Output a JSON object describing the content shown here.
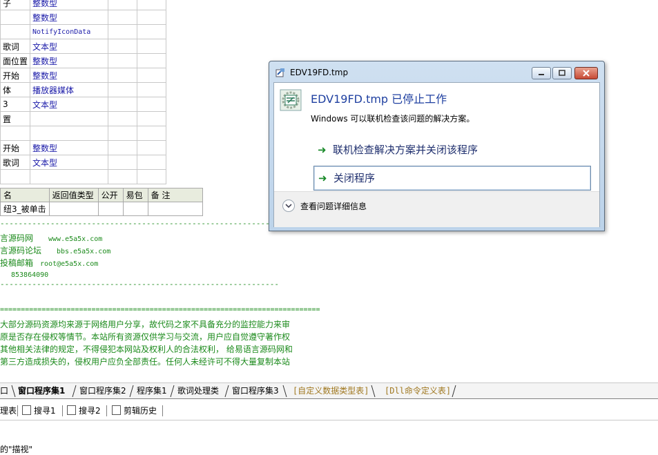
{
  "var_table": {
    "rows": [
      {
        "name": "子",
        "type": "整数型"
      },
      {
        "name": "",
        "type": "整数型"
      },
      {
        "name": "",
        "type": "NotifyIconData"
      },
      {
        "name": "歌词",
        "type": "文本型"
      },
      {
        "name": "面位置",
        "type": "整数型"
      },
      {
        "name": "开始",
        "type": "整数型"
      },
      {
        "name": "体",
        "type": "播放器媒体"
      },
      {
        "name": "3",
        "type": "文本型"
      },
      {
        "name": "置",
        "type": ""
      },
      {
        "name": "",
        "type": ""
      },
      {
        "name": "开始",
        "type": "整数型"
      },
      {
        "name": "歌词",
        "type": "文本型"
      },
      {
        "name": "",
        "type": ""
      }
    ]
  },
  "sub_table": {
    "headers": [
      "名",
      "返回值类型",
      "公开",
      "易包",
      "备 注"
    ],
    "row": [
      "纽3_被单击",
      "",
      "",
      "",
      ""
    ]
  },
  "comments": {
    "separator": "-------------------------------------------------------------",
    "lines": [
      {
        "label": "言源码网",
        "value": "www.e5a5x.com"
      },
      {
        "label": "言源码论坛",
        "value": "bbs.e5a5x.com"
      },
      {
        "label": "投稿邮箱",
        "value": "root@e5a5x.com"
      },
      {
        "label": "",
        "value": "853864090"
      }
    ],
    "double_separator": "=============================================================================",
    "disclaimer": [
      "大部分源码资源均来源于网络用户分享，故代码之家不具备充分的监控能力来审",
      "原是否存在侵权等情节。本站所有资源仅供学习与交流，用户应自觉遵守著作权",
      "其他相关法律的规定，不得侵犯本网站及权利人的合法权利， 给易语言源码网和",
      "第三方造成损失的，侵权用户应负全部责任。任何人未经许可不得大量复制本站"
    ]
  },
  "tabs": [
    "口",
    "窗口程序集1",
    "窗口程序集2",
    "程序集1",
    "歌词处理类",
    "窗口程序集3",
    "[自定义数据类型表]",
    "[Dll命令定义表]"
  ],
  "bottom_toolbar": {
    "items": [
      "理表",
      "搜寻1",
      "搜寻2",
      "剪辑历史"
    ]
  },
  "cutoff_text": "的\"描视\"",
  "dialog": {
    "title": "EDV19FD.tmp",
    "heading": "EDV19FD.tmp 已停止工作",
    "subtext": "Windows 可以联机检查该问题的解决方案。",
    "options": [
      "联机检查解决方案并关闭该程序",
      "关闭程序"
    ],
    "details_link": "查看问题详细信息",
    "colors": {
      "heading": "#1e3fa0",
      "option_arrow": "#1a8a2a"
    }
  }
}
